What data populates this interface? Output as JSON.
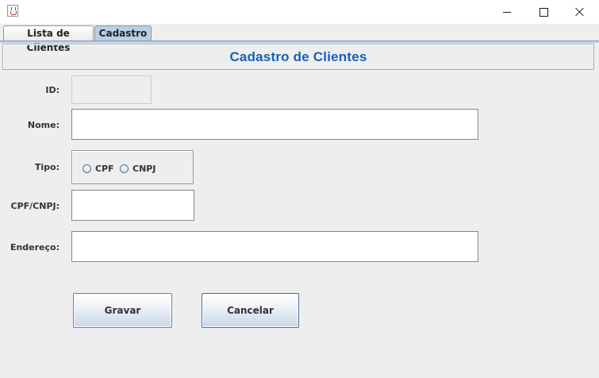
{
  "window": {
    "icon": "java-icon"
  },
  "tabs": [
    {
      "label": "Lista de Clientes",
      "selected": false
    },
    {
      "label": "Cadastro",
      "selected": true
    }
  ],
  "header": {
    "title": "Cadastro de Clientes",
    "title_color": "#1560bd"
  },
  "form": {
    "id": {
      "label": "ID:",
      "value": ""
    },
    "nome": {
      "label": "Nome:",
      "value": ""
    },
    "tipo": {
      "label": "Tipo:",
      "options": [
        "CPF",
        "CNPJ"
      ],
      "selected": null
    },
    "cpf_cnpj": {
      "label": "CPF/CNPJ:",
      "value": ""
    },
    "endereco": {
      "label": "Endereço:",
      "value": ""
    }
  },
  "buttons": {
    "gravar": "Gravar",
    "cancelar": "Cancelar"
  },
  "colors": {
    "tab_selected": "#b8cfe5",
    "background": "#eeeeee"
  }
}
